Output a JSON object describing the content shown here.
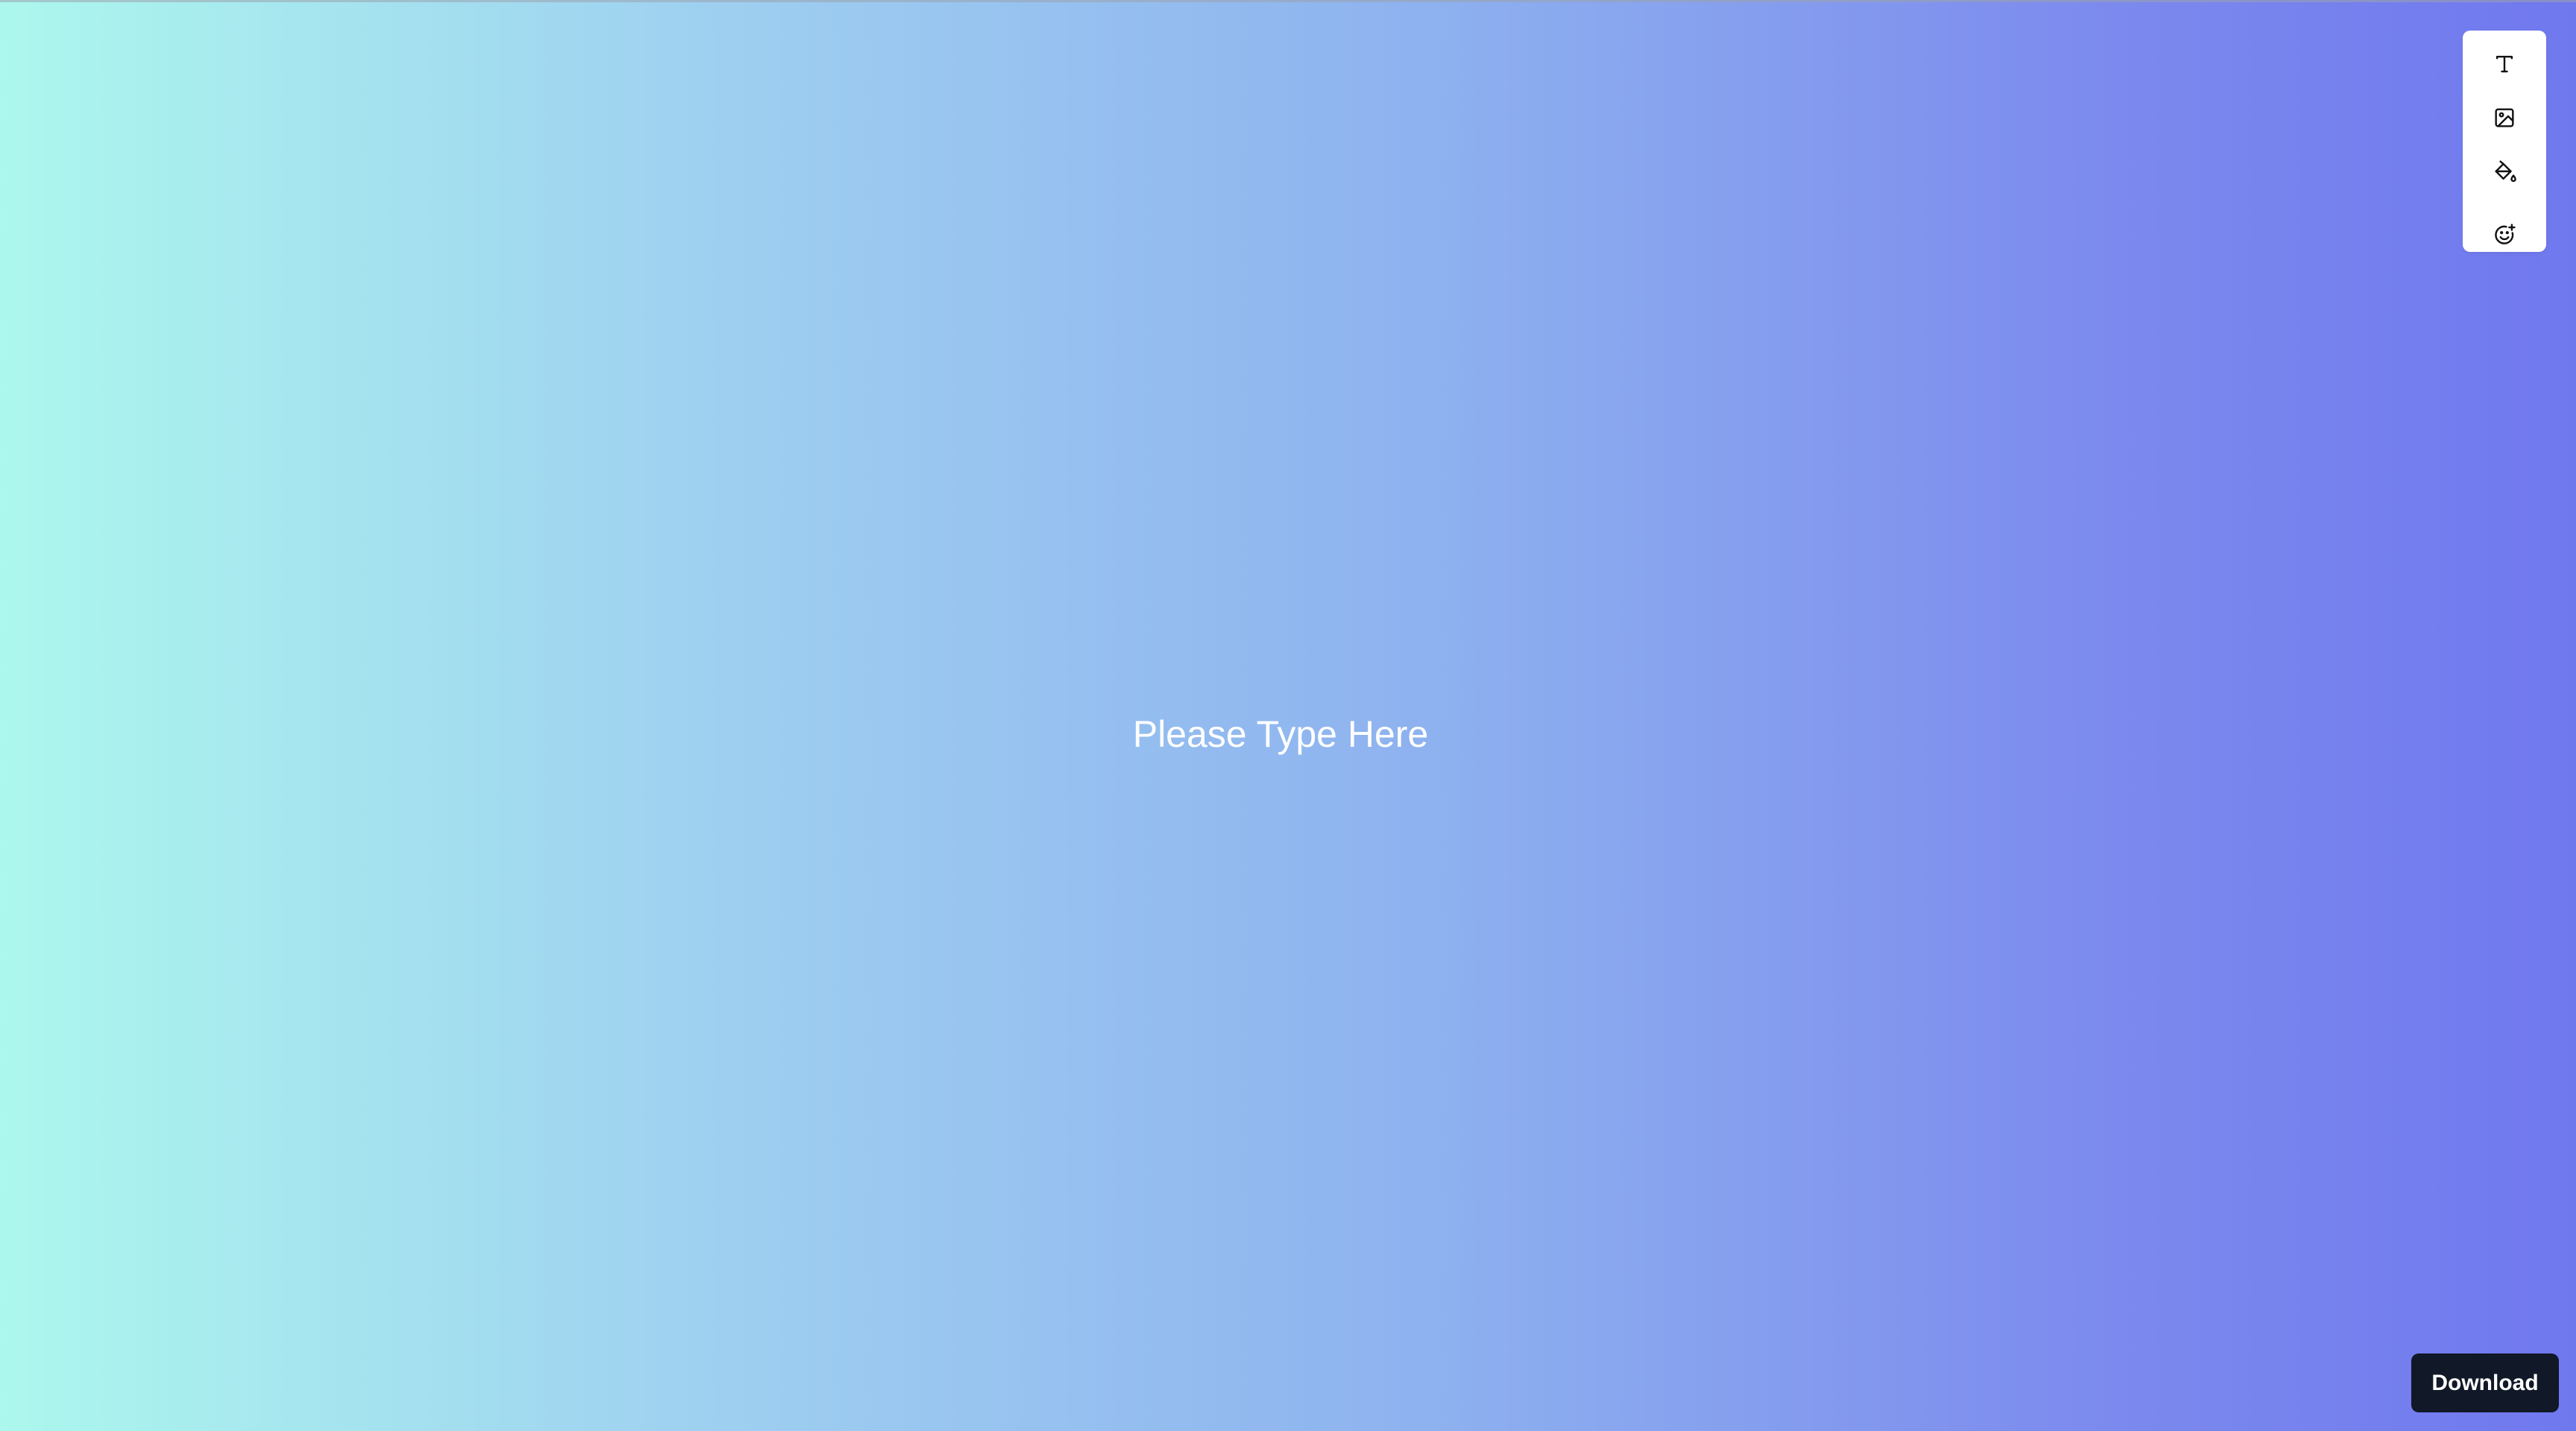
{
  "canvas": {
    "text": "Please Type Here",
    "background_gradient": [
      "#acf7ee",
      "#9ecff0",
      "#8eb2ef",
      "#7d8cee",
      "#7078ee"
    ],
    "text_color": "#ffffff"
  },
  "toolbar": {
    "tools": [
      {
        "icon": "text-icon"
      },
      {
        "icon": "image-icon"
      },
      {
        "icon": "paint-bucket-icon"
      },
      {
        "icon": "emoji-plus-icon"
      }
    ]
  },
  "download": {
    "label": "Download",
    "color": "#111827"
  }
}
